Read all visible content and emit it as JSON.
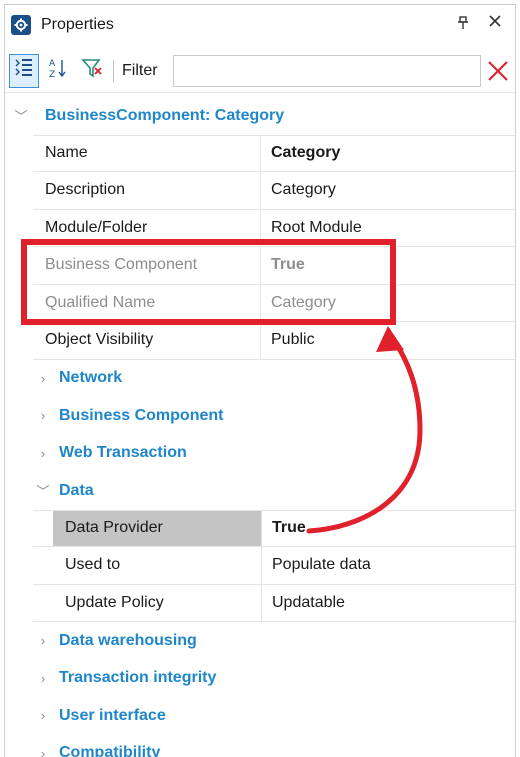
{
  "window": {
    "title": "Properties",
    "pin_glyph": "ꟷ",
    "close_glyph": "×"
  },
  "toolbar": {
    "filter_label": "Filter",
    "filter_value": ""
  },
  "grid": {
    "root_category": "BusinessComponent: Category",
    "rows": [
      {
        "name": "Name",
        "value": "Category",
        "bold": true,
        "disabled": false
      },
      {
        "name": "Description",
        "value": "Category",
        "bold": false,
        "disabled": false
      },
      {
        "name": "Module/Folder",
        "value": "Root Module",
        "bold": false,
        "disabled": false
      },
      {
        "name": "Business Component",
        "value": "True",
        "bold": true,
        "disabled": true
      },
      {
        "name": "Qualified Name",
        "value": "Category",
        "bold": false,
        "disabled": true
      },
      {
        "name": "Object Visibility",
        "value": "Public",
        "bold": false,
        "disabled": false
      }
    ],
    "collapsed_categories_1": [
      "Network",
      "Business Component",
      "Web Transaction"
    ],
    "expanded_category": "Data",
    "data_rows": [
      {
        "name": "Data Provider",
        "value": "True",
        "bold": true,
        "selected": true
      },
      {
        "name": "Used to",
        "value": "Populate data",
        "bold": false,
        "selected": false
      },
      {
        "name": "Update Policy",
        "value": "Updatable",
        "bold": false,
        "selected": false
      }
    ],
    "collapsed_categories_2": [
      "Data warehousing",
      "Transaction integrity",
      "User interface",
      "Compatibility"
    ]
  },
  "colors": {
    "category_text": "#1f87c9",
    "annotation_red": "#e0202a",
    "selected_row": "#c4c4c4",
    "disabled_text": "#8d8d8d"
  },
  "icons": {
    "app": "gear-icon",
    "sort_categorized": "categorized-icon",
    "sort_alpha": "sort-az-icon",
    "filter": "filter-icon",
    "clear": "clear-x-icon"
  }
}
